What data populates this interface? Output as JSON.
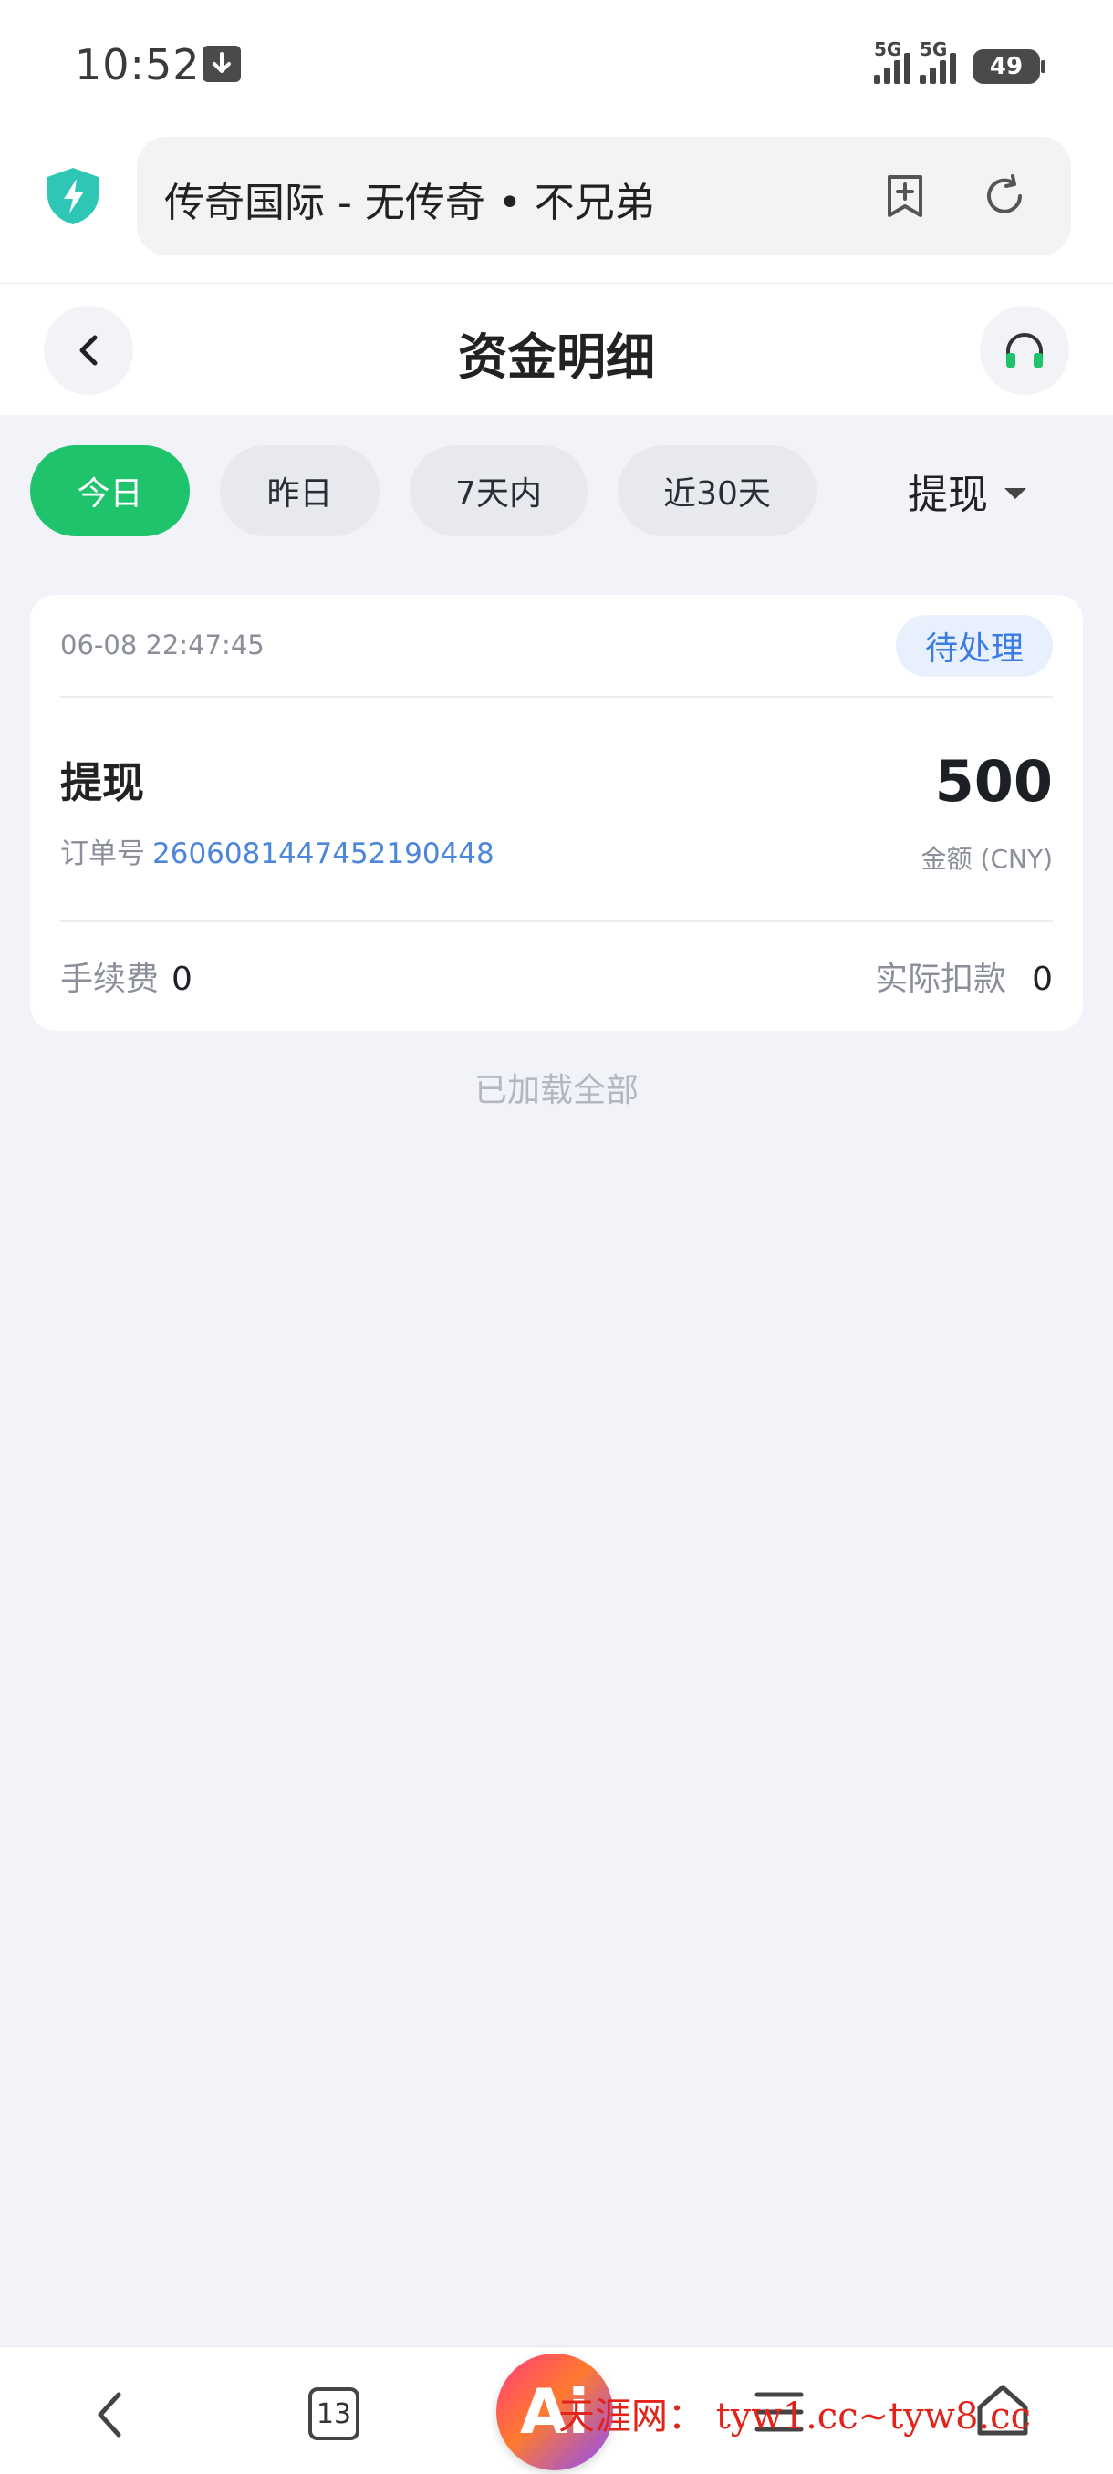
{
  "status_bar": {
    "time": "10:52",
    "signal_1": "5G",
    "signal_2": "5G",
    "battery": "49",
    "icons": [
      "download-icon",
      "signal-icon",
      "battery-icon"
    ]
  },
  "browser": {
    "url_title": "传奇国际 - 无传奇 • 不兄弟",
    "icons": [
      "shield-icon",
      "bookmark-add-icon",
      "refresh-icon"
    ]
  },
  "header": {
    "title": "资金明细",
    "icons": [
      "back-arrow-icon",
      "headset-icon"
    ]
  },
  "filters": {
    "items": [
      {
        "label": "今日",
        "active": true
      },
      {
        "label": "昨日",
        "active": false
      },
      {
        "label": "7天内",
        "active": false
      },
      {
        "label": "近30天",
        "active": false
      }
    ],
    "type_select": "提现"
  },
  "record": {
    "time": "06-08 22:47:45",
    "status": "待处理",
    "type": "提现",
    "order_label": "订单号",
    "order_no": "2606081447452190448",
    "amount": "500",
    "amount_label": "金额 (CNY)",
    "fee_label": "手续费",
    "fee_value": "0",
    "actual_label": "实际扣款",
    "actual_value": "0"
  },
  "list_footer": "已加载全部",
  "bottom_nav": {
    "tab_count": "13",
    "icons": [
      "nav-back-icon",
      "tabs-icon",
      "menu-icon",
      "home-icon"
    ]
  },
  "watermark": {
    "logo": "Ai",
    "text": "天涯网： tyw1.cc~tyw8.cc"
  },
  "colors": {
    "accent": "#1ec36b",
    "status_blue": "#3b7de3",
    "background": "#f1f3f8"
  }
}
